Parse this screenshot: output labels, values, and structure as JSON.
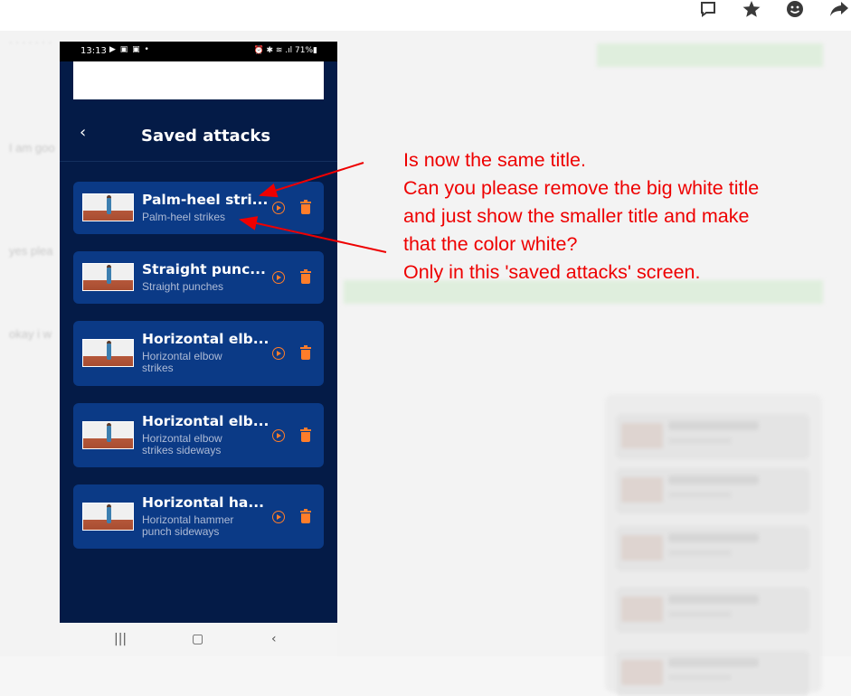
{
  "toolbar_icons": [
    "comment-icon",
    "star-icon",
    "smiley-icon",
    "share-icon"
  ],
  "status_bar": {
    "time": "13:13",
    "left_icons": "▶ ▣ ▣ •",
    "right_icons": "⏰ ✱ ≋ .ıl 71%▮"
  },
  "header": {
    "back_glyph": "‹",
    "title": "Saved attacks"
  },
  "attacks": [
    {
      "title": "Palm-heel stri...",
      "subtitle": "Palm-heel strikes"
    },
    {
      "title": "Straight punc...",
      "subtitle": "Straight punches"
    },
    {
      "title": "Horizontal elb...",
      "subtitle": "Horizontal elbow strikes"
    },
    {
      "title": "Horizontal elb...",
      "subtitle": "Horizontal elbow strikes sideways"
    },
    {
      "title": "Horizontal ha...",
      "subtitle": "Horizontal hammer punch sideways"
    }
  ],
  "nav_bar": {
    "recents": "|||",
    "home": "▢",
    "back": "‹"
  },
  "annotation": {
    "lines": [
      "Is now the same title.",
      "Can you please remove the big white title",
      "and just show the smaller title and make",
      "that the color white?",
      "Only in this 'saved attacks' screen."
    ],
    "color": "#ee0000"
  },
  "colors": {
    "phone_bg": "#041b47",
    "card_bg": "#0b3a86",
    "accent_orange": "#ff7d2a"
  }
}
